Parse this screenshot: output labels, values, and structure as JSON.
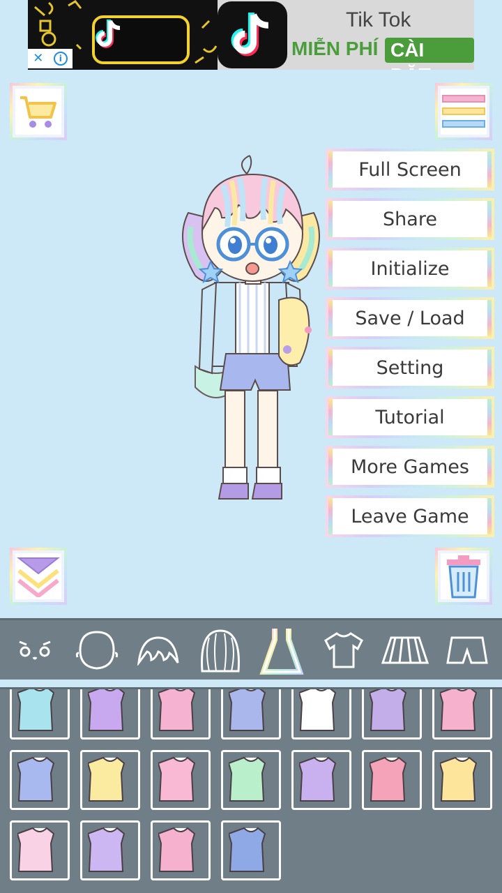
{
  "ad": {
    "title": "Tik Tok",
    "free_label": "MIỄN PHÍ",
    "install_label": "CÀI ĐẶT",
    "close_label": "✕",
    "info_label": "i"
  },
  "menu": {
    "items": [
      "Full Screen",
      "Share",
      "Initialize",
      "Save / Load",
      "Setting",
      "Tutorial",
      "More Games",
      "Leave Game"
    ]
  },
  "categories": [
    {
      "name": "face",
      "icon": "face-icon"
    },
    {
      "name": "head",
      "icon": "head-shape-icon"
    },
    {
      "name": "bangs",
      "icon": "bangs-icon"
    },
    {
      "name": "hair",
      "icon": "hair-icon"
    },
    {
      "name": "dress",
      "icon": "dress-icon",
      "selected": true
    },
    {
      "name": "top",
      "icon": "shirt-icon"
    },
    {
      "name": "skirt",
      "icon": "skirt-icon"
    },
    {
      "name": "shorts",
      "icon": "shorts-icon"
    }
  ],
  "items": [
    {
      "name": "overalls-blue",
      "color": "#a8e3ee"
    },
    {
      "name": "dress-lavender-sailor",
      "color": "#c8a9ef"
    },
    {
      "name": "dress-pink-long",
      "color": "#f6b3d1"
    },
    {
      "name": "dress-blue-bag",
      "color": "#a9b7ec"
    },
    {
      "name": "dress-white",
      "color": "#ffffff"
    },
    {
      "name": "coat-lavender",
      "color": "#c3aeea"
    },
    {
      "name": "dress-pink-sleeves",
      "color": "#f6b2cd"
    },
    {
      "name": "dress-blue-white",
      "color": "#a7b9ef"
    },
    {
      "name": "dress-yellow-paw",
      "color": "#fbeba0"
    },
    {
      "name": "dress-pink-frill",
      "color": "#f9b8d3"
    },
    {
      "name": "dress-mint",
      "color": "#b9efcb"
    },
    {
      "name": "dress-purple-fluffy",
      "color": "#c9b1f0"
    },
    {
      "name": "coat-pink",
      "color": "#f5a3b9"
    },
    {
      "name": "dress-yellow",
      "color": "#fde59c"
    },
    {
      "name": "dress-rainbow-tiered",
      "color": "#f9d2e6"
    },
    {
      "name": "dress-maid",
      "color": "#cdb7f3"
    },
    {
      "name": "dress-pink-collar",
      "color": "#f6b1cf"
    },
    {
      "name": "overalls-denim",
      "color": "#8fa9e6"
    }
  ]
}
